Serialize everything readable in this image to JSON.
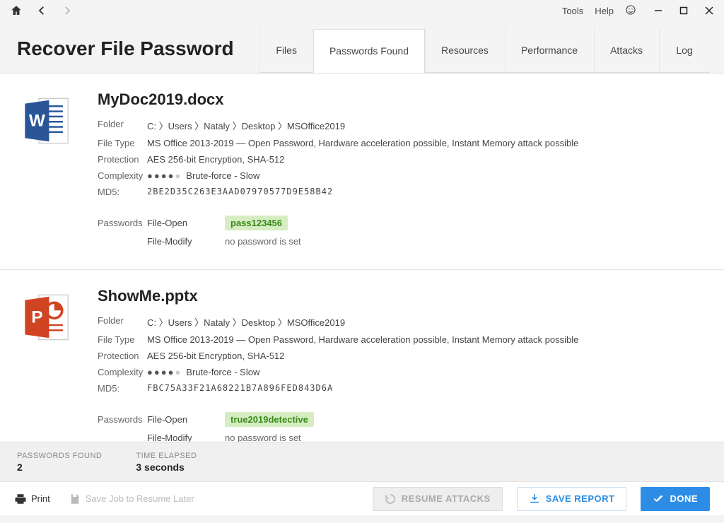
{
  "menu": {
    "tools": "Tools",
    "help": "Help"
  },
  "page_title": "Recover File Password",
  "tabs": {
    "files": "Files",
    "passwords_found": "Passwords Found",
    "resources": "Resources",
    "performance": "Performance",
    "attacks": "Attacks",
    "log": "Log"
  },
  "labels": {
    "folder": "Folder",
    "file_type": "File Type",
    "protection": "Protection",
    "complexity": "Complexity",
    "md5": "MD5:",
    "passwords": "Passwords",
    "file_open": "File-Open",
    "file_modify": "File-Modify",
    "no_password": "no password is set"
  },
  "files": [
    {
      "icon": "word",
      "name": "MyDoc2019.docx",
      "folder": "C: 〉Users 〉Nataly 〉Desktop 〉MSOffice2019",
      "file_type": "MS Office 2013-2019 — Open Password, Hardware acceleration possible, Instant Memory attack possible",
      "protection": "AES 256-bit Encryption, SHA-512",
      "complexity_level": 4,
      "complexity_text": "Brute-force - Slow",
      "md5": "2BE2D35C263E3AAD07970577D9E58B42",
      "open_password": "pass123456",
      "modify_password": null
    },
    {
      "icon": "powerpoint",
      "name": "ShowMe.pptx",
      "folder": "C: 〉Users 〉Nataly 〉Desktop 〉MSOffice2019",
      "file_type": "MS Office 2013-2019 — Open Password, Hardware acceleration possible, Instant Memory attack possible",
      "protection": "AES 256-bit Encryption, SHA-512",
      "complexity_level": 4,
      "complexity_text": "Brute-force - Slow",
      "md5": "FBC75A33F21A68221B7A896FED843D6A",
      "open_password": "true2019detective",
      "modify_password": null
    }
  ],
  "summary": {
    "passwords_found_label": "PASSWORDS FOUND",
    "passwords_found_value": "2",
    "time_elapsed_label": "TIME ELAPSED",
    "time_elapsed_value": "3 seconds"
  },
  "actions": {
    "print": "Print",
    "save_job": "Save Job to Resume Later",
    "resume": "RESUME ATTACKS",
    "save_report": "SAVE REPORT",
    "done": "DONE"
  },
  "colors": {
    "accent_blue": "#2d8de6",
    "password_green_bg": "#d6edc2",
    "password_green_fg": "#3a8a1a",
    "word_blue": "#2a5699",
    "ppt_orange": "#d04424"
  }
}
